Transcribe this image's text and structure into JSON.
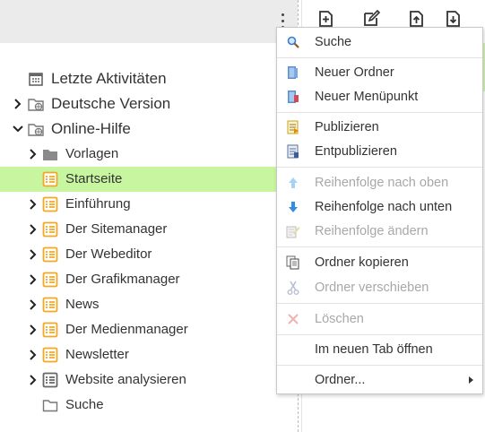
{
  "tree": {
    "nodes": [
      {
        "label": "Letzte Aktivitäten",
        "icon": "calendar-icon",
        "chevron": "none"
      },
      {
        "label": "Deutsche Version",
        "icon": "web-folder-icon",
        "chevron": "right"
      },
      {
        "label": "Online-Hilfe",
        "icon": "web-folder-icon",
        "chevron": "down"
      },
      {
        "label": "Vorlagen",
        "icon": "folder-icon",
        "chevron": "right"
      },
      {
        "label": "Startseite",
        "icon": "page-list-icon",
        "chevron": "none",
        "selected": true
      },
      {
        "label": "Einführung",
        "icon": "page-list-icon",
        "chevron": "right"
      },
      {
        "label": "Der Sitemanager",
        "icon": "page-list-icon",
        "chevron": "right"
      },
      {
        "label": "Der Webeditor",
        "icon": "page-list-icon",
        "chevron": "right"
      },
      {
        "label": "Der Grafikmanager",
        "icon": "page-list-icon",
        "chevron": "right"
      },
      {
        "label": "News",
        "icon": "page-list-icon",
        "chevron": "right"
      },
      {
        "label": "Der Medienmanager",
        "icon": "page-list-icon",
        "chevron": "right"
      },
      {
        "label": "Newsletter",
        "icon": "page-list-icon",
        "chevron": "right"
      },
      {
        "label": "Website analysieren",
        "icon": "list-icon",
        "chevron": "right"
      },
      {
        "label": "Suche",
        "icon": "folder-outline-icon",
        "chevron": "none"
      }
    ]
  },
  "context_menu": {
    "items": [
      {
        "label": "Suche",
        "icon": "magnifier-icon",
        "enabled": true
      },
      {
        "label": "Neuer Ordner",
        "icon": "new-folder-icon",
        "enabled": true
      },
      {
        "label": "Neuer Menüpunkt",
        "icon": "new-menu-item-icon",
        "enabled": true
      },
      {
        "label": "Publizieren",
        "icon": "publish-icon",
        "enabled": true
      },
      {
        "label": "Entpublizieren",
        "icon": "unpublish-icon",
        "enabled": true
      },
      {
        "label": "Reihenfolge nach oben",
        "icon": "arrow-up-icon",
        "enabled": false
      },
      {
        "label": "Reihenfolge nach unten",
        "icon": "arrow-down-icon",
        "enabled": true
      },
      {
        "label": "Reihenfolge ändern",
        "icon": "edit-order-icon",
        "enabled": false
      },
      {
        "label": "Ordner kopieren",
        "icon": "copy-icon",
        "enabled": true
      },
      {
        "label": "Ordner verschieben",
        "icon": "cut-icon",
        "enabled": false
      },
      {
        "label": "Löschen",
        "icon": "delete-icon",
        "enabled": false
      },
      {
        "label": "Im neuen Tab öffnen",
        "icon": "",
        "enabled": true
      },
      {
        "label": "Ordner...",
        "icon": "",
        "enabled": true,
        "submenu": true
      }
    ]
  },
  "toolbar": {
    "icons": [
      "add-page-icon",
      "edit-icon",
      "upload-icon",
      "download-icon"
    ]
  },
  "colors": {
    "selected_row": "#c8f5a0",
    "page_icon": "#f5a623",
    "disabled_text": "#a8a8a8"
  }
}
